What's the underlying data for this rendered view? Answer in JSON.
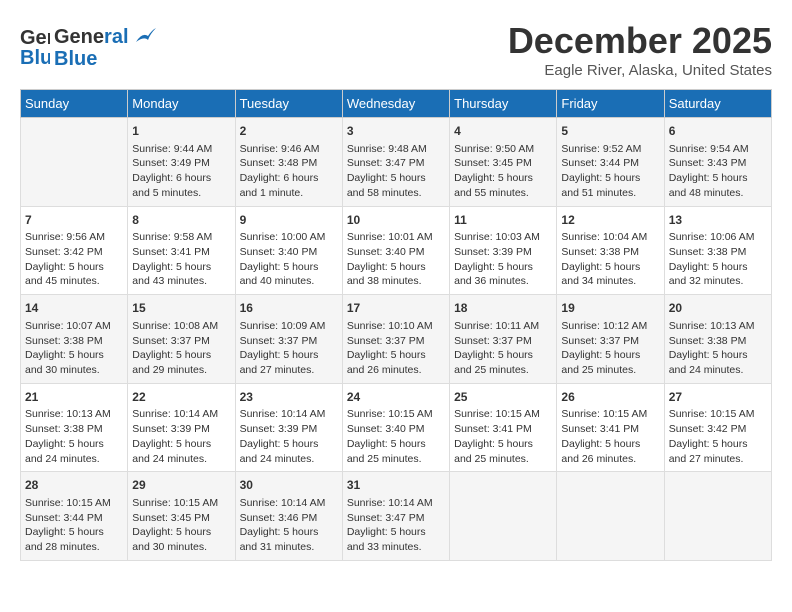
{
  "header": {
    "logo_line1": "General",
    "logo_line2": "Blue",
    "main_title": "December 2025",
    "subtitle": "Eagle River, Alaska, United States"
  },
  "calendar": {
    "days_of_week": [
      "Sunday",
      "Monday",
      "Tuesday",
      "Wednesday",
      "Thursday",
      "Friday",
      "Saturday"
    ],
    "weeks": [
      [
        {
          "day": "",
          "info": ""
        },
        {
          "day": "1",
          "info": "Sunrise: 9:44 AM\nSunset: 3:49 PM\nDaylight: 6 hours\nand 5 minutes."
        },
        {
          "day": "2",
          "info": "Sunrise: 9:46 AM\nSunset: 3:48 PM\nDaylight: 6 hours\nand 1 minute."
        },
        {
          "day": "3",
          "info": "Sunrise: 9:48 AM\nSunset: 3:47 PM\nDaylight: 5 hours\nand 58 minutes."
        },
        {
          "day": "4",
          "info": "Sunrise: 9:50 AM\nSunset: 3:45 PM\nDaylight: 5 hours\nand 55 minutes."
        },
        {
          "day": "5",
          "info": "Sunrise: 9:52 AM\nSunset: 3:44 PM\nDaylight: 5 hours\nand 51 minutes."
        },
        {
          "day": "6",
          "info": "Sunrise: 9:54 AM\nSunset: 3:43 PM\nDaylight: 5 hours\nand 48 minutes."
        }
      ],
      [
        {
          "day": "7",
          "info": "Sunrise: 9:56 AM\nSunset: 3:42 PM\nDaylight: 5 hours\nand 45 minutes."
        },
        {
          "day": "8",
          "info": "Sunrise: 9:58 AM\nSunset: 3:41 PM\nDaylight: 5 hours\nand 43 minutes."
        },
        {
          "day": "9",
          "info": "Sunrise: 10:00 AM\nSunset: 3:40 PM\nDaylight: 5 hours\nand 40 minutes."
        },
        {
          "day": "10",
          "info": "Sunrise: 10:01 AM\nSunset: 3:40 PM\nDaylight: 5 hours\nand 38 minutes."
        },
        {
          "day": "11",
          "info": "Sunrise: 10:03 AM\nSunset: 3:39 PM\nDaylight: 5 hours\nand 36 minutes."
        },
        {
          "day": "12",
          "info": "Sunrise: 10:04 AM\nSunset: 3:38 PM\nDaylight: 5 hours\nand 34 minutes."
        },
        {
          "day": "13",
          "info": "Sunrise: 10:06 AM\nSunset: 3:38 PM\nDaylight: 5 hours\nand 32 minutes."
        }
      ],
      [
        {
          "day": "14",
          "info": "Sunrise: 10:07 AM\nSunset: 3:38 PM\nDaylight: 5 hours\nand 30 minutes."
        },
        {
          "day": "15",
          "info": "Sunrise: 10:08 AM\nSunset: 3:37 PM\nDaylight: 5 hours\nand 29 minutes."
        },
        {
          "day": "16",
          "info": "Sunrise: 10:09 AM\nSunset: 3:37 PM\nDaylight: 5 hours\nand 27 minutes."
        },
        {
          "day": "17",
          "info": "Sunrise: 10:10 AM\nSunset: 3:37 PM\nDaylight: 5 hours\nand 26 minutes."
        },
        {
          "day": "18",
          "info": "Sunrise: 10:11 AM\nSunset: 3:37 PM\nDaylight: 5 hours\nand 25 minutes."
        },
        {
          "day": "19",
          "info": "Sunrise: 10:12 AM\nSunset: 3:37 PM\nDaylight: 5 hours\nand 25 minutes."
        },
        {
          "day": "20",
          "info": "Sunrise: 10:13 AM\nSunset: 3:38 PM\nDaylight: 5 hours\nand 24 minutes."
        }
      ],
      [
        {
          "day": "21",
          "info": "Sunrise: 10:13 AM\nSunset: 3:38 PM\nDaylight: 5 hours\nand 24 minutes."
        },
        {
          "day": "22",
          "info": "Sunrise: 10:14 AM\nSunset: 3:39 PM\nDaylight: 5 hours\nand 24 minutes."
        },
        {
          "day": "23",
          "info": "Sunrise: 10:14 AM\nSunset: 3:39 PM\nDaylight: 5 hours\nand 24 minutes."
        },
        {
          "day": "24",
          "info": "Sunrise: 10:15 AM\nSunset: 3:40 PM\nDaylight: 5 hours\nand 25 minutes."
        },
        {
          "day": "25",
          "info": "Sunrise: 10:15 AM\nSunset: 3:41 PM\nDaylight: 5 hours\nand 25 minutes."
        },
        {
          "day": "26",
          "info": "Sunrise: 10:15 AM\nSunset: 3:41 PM\nDaylight: 5 hours\nand 26 minutes."
        },
        {
          "day": "27",
          "info": "Sunrise: 10:15 AM\nSunset: 3:42 PM\nDaylight: 5 hours\nand 27 minutes."
        }
      ],
      [
        {
          "day": "28",
          "info": "Sunrise: 10:15 AM\nSunset: 3:44 PM\nDaylight: 5 hours\nand 28 minutes."
        },
        {
          "day": "29",
          "info": "Sunrise: 10:15 AM\nSunset: 3:45 PM\nDaylight: 5 hours\nand 30 minutes."
        },
        {
          "day": "30",
          "info": "Sunrise: 10:14 AM\nSunset: 3:46 PM\nDaylight: 5 hours\nand 31 minutes."
        },
        {
          "day": "31",
          "info": "Sunrise: 10:14 AM\nSunset: 3:47 PM\nDaylight: 5 hours\nand 33 minutes."
        },
        {
          "day": "",
          "info": ""
        },
        {
          "day": "",
          "info": ""
        },
        {
          "day": "",
          "info": ""
        }
      ]
    ]
  }
}
